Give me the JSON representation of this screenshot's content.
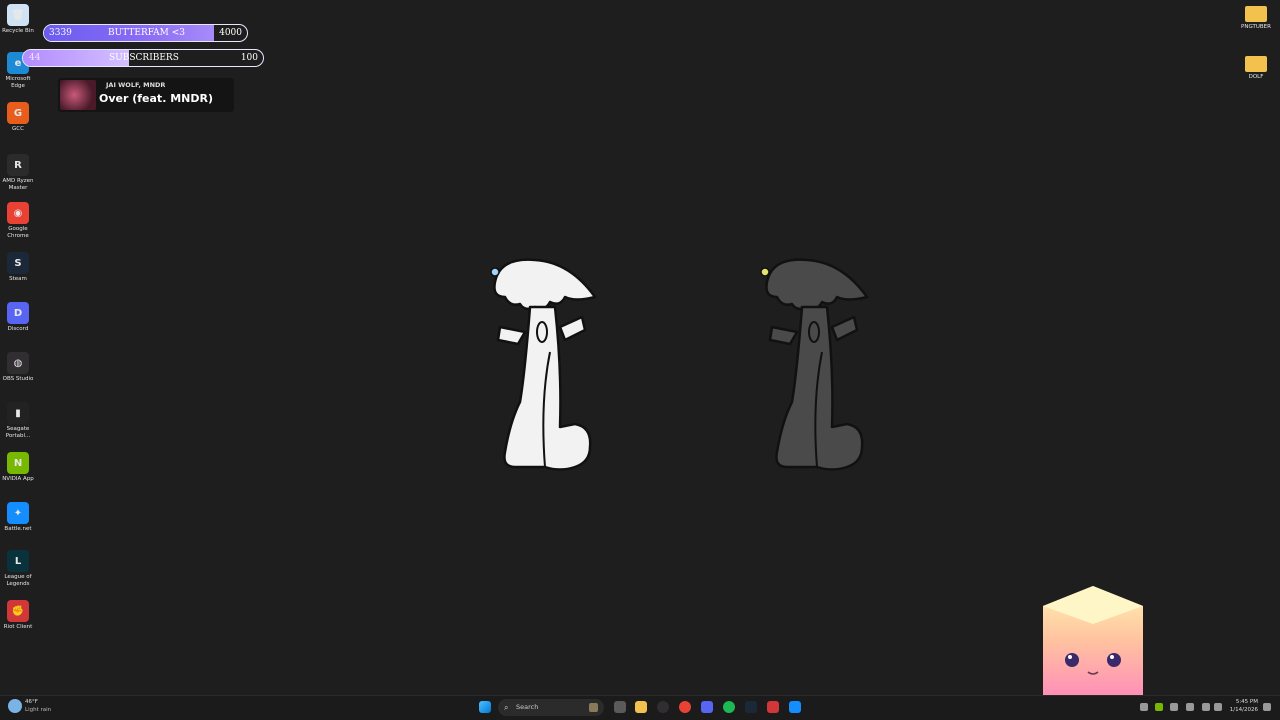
{
  "desktop_icons_left": [
    {
      "label": "Recycle Bin",
      "icon": "recycle-bin-icon",
      "color": "#cfe3f5",
      "glyph": "🗑"
    },
    {
      "label": "Microsoft Edge",
      "icon": "edge-icon",
      "color": "#1d8ad6",
      "glyph": "e"
    },
    {
      "label": "GCC",
      "icon": "gcc-icon",
      "color": "#e85d1c",
      "glyph": "G"
    },
    {
      "label": "AMD Ryzen Master",
      "icon": "amd-ryzen-icon",
      "color": "#2b2b2b",
      "glyph": "R"
    },
    {
      "label": "Google Chrome",
      "icon": "chrome-icon",
      "color": "#e94235",
      "glyph": "◉"
    },
    {
      "label": "Steam",
      "icon": "steam-icon",
      "color": "#1b2838",
      "glyph": "S"
    },
    {
      "label": "Discord",
      "icon": "discord-icon",
      "color": "#5865f2",
      "glyph": "D"
    },
    {
      "label": "OBS Studio",
      "icon": "obs-icon",
      "color": "#302e31",
      "glyph": "◍"
    },
    {
      "label": "Seagate Portabl...",
      "icon": "seagate-icon",
      "color": "#222222",
      "glyph": "▮"
    },
    {
      "label": "NVIDIA App",
      "icon": "nvidia-icon",
      "color": "#76b900",
      "glyph": "N"
    },
    {
      "label": "Battle.net",
      "icon": "battlenet-icon",
      "color": "#148eff",
      "glyph": "✦"
    },
    {
      "label": "League of Legends",
      "icon": "league-icon",
      "color": "#0a323c",
      "glyph": "L"
    },
    {
      "label": "Riot Client",
      "icon": "riot-icon",
      "color": "#d13639",
      "glyph": "✊"
    }
  ],
  "desktop_icons_right": [
    {
      "label": "PNGTUBER",
      "icon": "folder-icon",
      "color": "#f2c14e"
    },
    {
      "label": "DOLF",
      "icon": "folder-icon",
      "color": "#f2c14e"
    }
  ],
  "follower_goal": {
    "current": "3339",
    "label": "BUTTERFAM <3",
    "target": "4000",
    "progress": 0.835
  },
  "sub_goal": {
    "current": "44",
    "label": "SUBSCRIBERS",
    "target": "100",
    "progress": 0.44
  },
  "now_playing": {
    "artist": "JAI WOLF, MNDR",
    "title": "Over (feat. MNDR)"
  },
  "taskbar": {
    "weather_temp": "46°F",
    "weather_desc": "Light rain",
    "search_placeholder": "Search",
    "time": "5:45 PM",
    "date": "1/14/2026"
  },
  "colors": {
    "desktop_bg": "#1e1e1e",
    "goal_fill": "#6a5cf0",
    "sub_fill": "#c4a7ff"
  }
}
